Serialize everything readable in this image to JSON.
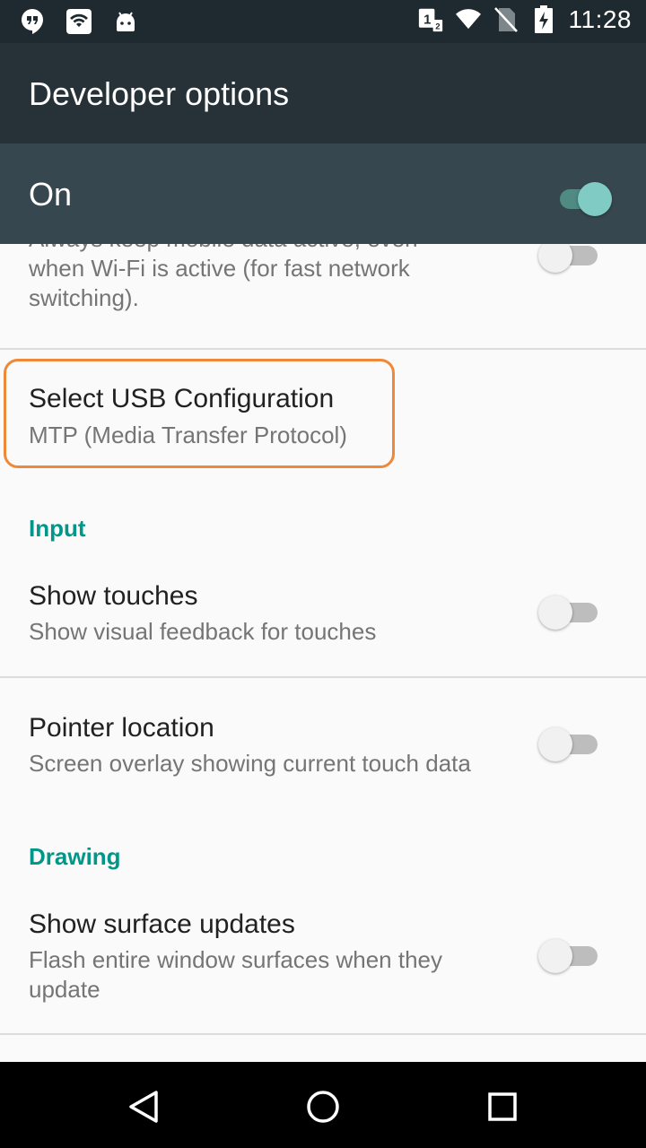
{
  "status_bar": {
    "time": "11:28",
    "icons_left": [
      "hangouts-icon",
      "wifi-box-icon",
      "android-icon"
    ],
    "icons_right": [
      "sim-dual-icon",
      "wifi-signal-icon",
      "no-sim-icon",
      "battery-charging-icon"
    ]
  },
  "app_bar": {
    "title": "Developer options"
  },
  "master": {
    "label": "On",
    "enabled": true
  },
  "items": {
    "mobile_data": {
      "summary": "Always keep mobile data active, even when Wi-Fi is active (for fast network switching).",
      "enabled": false
    },
    "usb_config": {
      "title": "Select USB Configuration",
      "summary": "MTP (Media Transfer Protocol)"
    },
    "input_category": "Input",
    "show_touches": {
      "title": "Show touches",
      "summary": "Show visual feedback for touches",
      "enabled": false
    },
    "pointer_location": {
      "title": "Pointer location",
      "summary": "Screen overlay showing current touch data",
      "enabled": false
    },
    "drawing_category": "Drawing",
    "surface_updates": {
      "title": "Show surface updates",
      "summary": "Flash entire window surfaces when they update",
      "enabled": false
    }
  },
  "colors": {
    "accent": "#009688",
    "highlight": "#f0883a",
    "app_bar": "#263238",
    "master_bar": "#37474f"
  },
  "nav_bar": {
    "buttons": [
      "back-icon",
      "home-icon",
      "recents-icon"
    ]
  }
}
